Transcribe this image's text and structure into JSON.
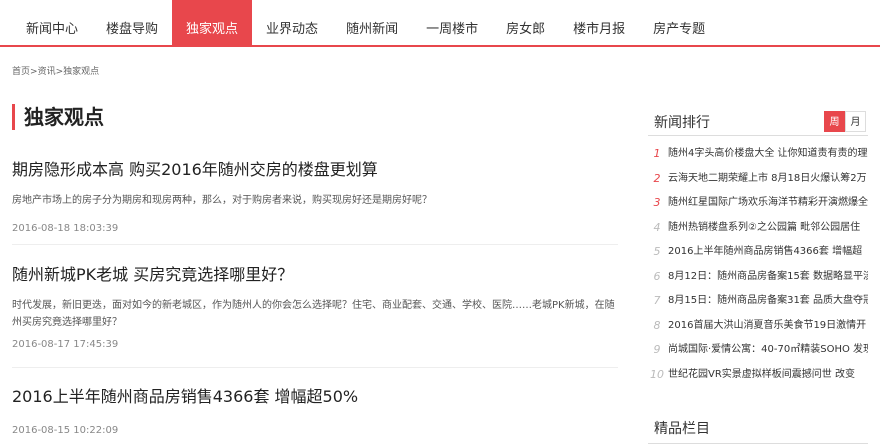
{
  "nav": {
    "items": [
      "新闻中心",
      "楼盘导购",
      "独家观点",
      "业界动态",
      "随州新闻",
      "一周楼市",
      "房女郎",
      "楼市月报",
      "房产专题"
    ],
    "active_index": 2
  },
  "breadcrumb": {
    "home": "首页",
    "sep": ">",
    "news": "资讯",
    "current": "独家观点"
  },
  "page_title": "独家观点",
  "articles": [
    {
      "title": "期房隐形成本高 购买2016年随州交房的楼盘更划算",
      "summary": "房地产市场上的房子分为期房和现房两种，那么，对于购房者来说，购买现房好还是期房好呢？",
      "date": "2016-08-18 18:03:39"
    },
    {
      "title": "随州新城PK老城 买房究竟选择哪里好？",
      "summary": "时代发展，新旧更迭，面对如今的新老城区，作为随州人的你会怎么选择呢？住宅、商业配套、交通、学校、医院……老城PK新城，在随州买房究竟选择哪里好？",
      "date": "2016-08-17 17:45:39"
    },
    {
      "title": "2016上半年随州商品房销售4366套 增幅超50%",
      "summary": "",
      "date": "2016-08-15 10:22:09"
    }
  ],
  "sidebar": {
    "ranking_title": "新闻排行",
    "tab_week": "周",
    "tab_month": "月",
    "items": [
      {
        "num": "1",
        "text": "随州4字头高价楼盘大全 让你知道责有责的理"
      },
      {
        "num": "2",
        "text": "云海天地二期荣耀上市 8月18日火爆认筹2万"
      },
      {
        "num": "3",
        "text": "随州红星国际广场欢乐海洋节精彩开演燃爆全"
      },
      {
        "num": "4",
        "text": "随州热销楼盘系列②之公园篇 毗邻公园居住"
      },
      {
        "num": "5",
        "text": "2016上半年随州商品房销售4366套 增幅超"
      },
      {
        "num": "6",
        "text": "8月12日：随州商品房备案15套 数据略显平淡"
      },
      {
        "num": "7",
        "text": "8月15日：随州商品房备案31套 品质大盘夺冠"
      },
      {
        "num": "8",
        "text": "2016首届大洪山消夏音乐美食节19日激情开"
      },
      {
        "num": "9",
        "text": "尚城国际·爱情公寓：40-70㎡精装SOHO 发现"
      },
      {
        "num": "10",
        "text": "世纪花园VR实景虚拟样板间震撼问世 改变"
      }
    ],
    "featured_title": "精品栏目"
  },
  "colors": {
    "accent": "#e8474c"
  }
}
